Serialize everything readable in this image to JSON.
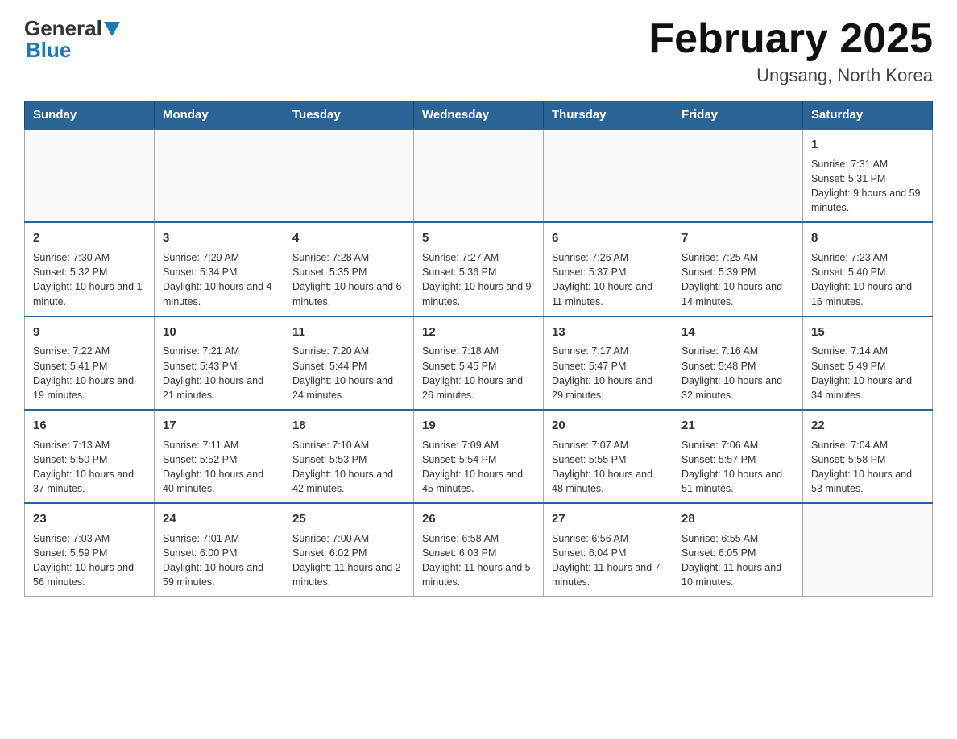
{
  "header": {
    "logo_general": "General",
    "logo_blue": "Blue",
    "title": "February 2025",
    "location": "Ungsang, North Korea"
  },
  "days_of_week": [
    "Sunday",
    "Monday",
    "Tuesday",
    "Wednesday",
    "Thursday",
    "Friday",
    "Saturday"
  ],
  "weeks": [
    [
      {
        "day": "",
        "info": ""
      },
      {
        "day": "",
        "info": ""
      },
      {
        "day": "",
        "info": ""
      },
      {
        "day": "",
        "info": ""
      },
      {
        "day": "",
        "info": ""
      },
      {
        "day": "",
        "info": ""
      },
      {
        "day": "1",
        "info": "Sunrise: 7:31 AM\nSunset: 5:31 PM\nDaylight: 9 hours and 59 minutes."
      }
    ],
    [
      {
        "day": "2",
        "info": "Sunrise: 7:30 AM\nSunset: 5:32 PM\nDaylight: 10 hours and 1 minute."
      },
      {
        "day": "3",
        "info": "Sunrise: 7:29 AM\nSunset: 5:34 PM\nDaylight: 10 hours and 4 minutes."
      },
      {
        "day": "4",
        "info": "Sunrise: 7:28 AM\nSunset: 5:35 PM\nDaylight: 10 hours and 6 minutes."
      },
      {
        "day": "5",
        "info": "Sunrise: 7:27 AM\nSunset: 5:36 PM\nDaylight: 10 hours and 9 minutes."
      },
      {
        "day": "6",
        "info": "Sunrise: 7:26 AM\nSunset: 5:37 PM\nDaylight: 10 hours and 11 minutes."
      },
      {
        "day": "7",
        "info": "Sunrise: 7:25 AM\nSunset: 5:39 PM\nDaylight: 10 hours and 14 minutes."
      },
      {
        "day": "8",
        "info": "Sunrise: 7:23 AM\nSunset: 5:40 PM\nDaylight: 10 hours and 16 minutes."
      }
    ],
    [
      {
        "day": "9",
        "info": "Sunrise: 7:22 AM\nSunset: 5:41 PM\nDaylight: 10 hours and 19 minutes."
      },
      {
        "day": "10",
        "info": "Sunrise: 7:21 AM\nSunset: 5:43 PM\nDaylight: 10 hours and 21 minutes."
      },
      {
        "day": "11",
        "info": "Sunrise: 7:20 AM\nSunset: 5:44 PM\nDaylight: 10 hours and 24 minutes."
      },
      {
        "day": "12",
        "info": "Sunrise: 7:18 AM\nSunset: 5:45 PM\nDaylight: 10 hours and 26 minutes."
      },
      {
        "day": "13",
        "info": "Sunrise: 7:17 AM\nSunset: 5:47 PM\nDaylight: 10 hours and 29 minutes."
      },
      {
        "day": "14",
        "info": "Sunrise: 7:16 AM\nSunset: 5:48 PM\nDaylight: 10 hours and 32 minutes."
      },
      {
        "day": "15",
        "info": "Sunrise: 7:14 AM\nSunset: 5:49 PM\nDaylight: 10 hours and 34 minutes."
      }
    ],
    [
      {
        "day": "16",
        "info": "Sunrise: 7:13 AM\nSunset: 5:50 PM\nDaylight: 10 hours and 37 minutes."
      },
      {
        "day": "17",
        "info": "Sunrise: 7:11 AM\nSunset: 5:52 PM\nDaylight: 10 hours and 40 minutes."
      },
      {
        "day": "18",
        "info": "Sunrise: 7:10 AM\nSunset: 5:53 PM\nDaylight: 10 hours and 42 minutes."
      },
      {
        "day": "19",
        "info": "Sunrise: 7:09 AM\nSunset: 5:54 PM\nDaylight: 10 hours and 45 minutes."
      },
      {
        "day": "20",
        "info": "Sunrise: 7:07 AM\nSunset: 5:55 PM\nDaylight: 10 hours and 48 minutes."
      },
      {
        "day": "21",
        "info": "Sunrise: 7:06 AM\nSunset: 5:57 PM\nDaylight: 10 hours and 51 minutes."
      },
      {
        "day": "22",
        "info": "Sunrise: 7:04 AM\nSunset: 5:58 PM\nDaylight: 10 hours and 53 minutes."
      }
    ],
    [
      {
        "day": "23",
        "info": "Sunrise: 7:03 AM\nSunset: 5:59 PM\nDaylight: 10 hours and 56 minutes."
      },
      {
        "day": "24",
        "info": "Sunrise: 7:01 AM\nSunset: 6:00 PM\nDaylight: 10 hours and 59 minutes."
      },
      {
        "day": "25",
        "info": "Sunrise: 7:00 AM\nSunset: 6:02 PM\nDaylight: 11 hours and 2 minutes."
      },
      {
        "day": "26",
        "info": "Sunrise: 6:58 AM\nSunset: 6:03 PM\nDaylight: 11 hours and 5 minutes."
      },
      {
        "day": "27",
        "info": "Sunrise: 6:56 AM\nSunset: 6:04 PM\nDaylight: 11 hours and 7 minutes."
      },
      {
        "day": "28",
        "info": "Sunrise: 6:55 AM\nSunset: 6:05 PM\nDaylight: 11 hours and 10 minutes."
      },
      {
        "day": "",
        "info": ""
      }
    ]
  ]
}
